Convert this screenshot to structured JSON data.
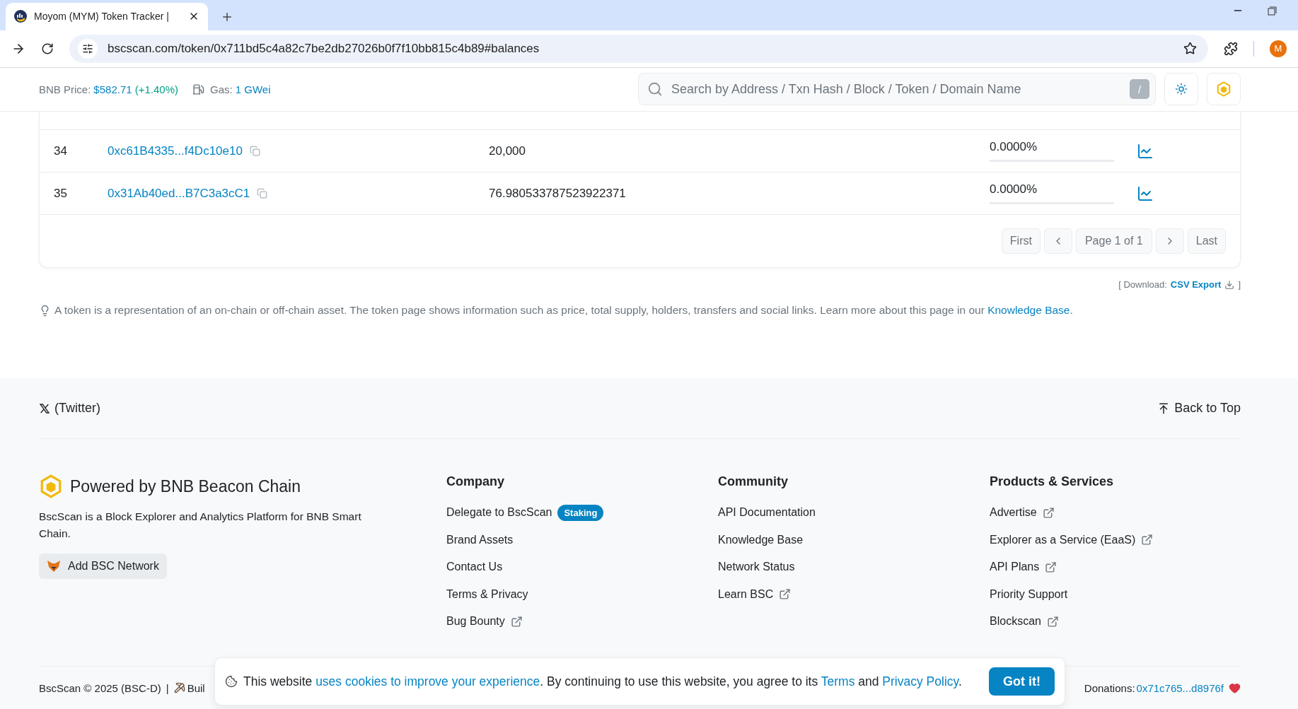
{
  "browser": {
    "tab_title": "Moyom (MYM) Token Tracker |",
    "url": "bscscan.com/token/0x711bd5c4a82c7be2db27026b0f7f10bb815c4b89#balances",
    "avatar": "M"
  },
  "header": {
    "price_label": "BNB Price:",
    "price": "$582.71",
    "change": "(+1.40%)",
    "gas_label": "Gas:",
    "gas": "1 GWei",
    "search_placeholder": "Search by Address / Txn Hash / Block / Token / Domain Name",
    "shortcut": "/"
  },
  "holders": {
    "rows": [
      {
        "rank": "34",
        "address": "0xc61B4335...f4Dc10e10",
        "quantity": "20,000",
        "percentage": "0.0000%",
        "level": 0
      },
      {
        "rank": "35",
        "address": "0x31Ab40ed...B7C3a3cC1",
        "quantity": "76.980533787523922371",
        "percentage": "0.0000%",
        "level": 0
      }
    ],
    "pagination": {
      "first": "First",
      "page": "Page 1 of 1",
      "last": "Last"
    }
  },
  "download": {
    "prefix": "[ Download:",
    "link": "CSV Export",
    "suffix": "]"
  },
  "info": {
    "text": "A token is a representation of an on-chain or off-chain asset. The token page shows information such as price, total supply, holders, transfers and social links. Learn more about this page in our ",
    "link": "Knowledge Base",
    "end": "."
  },
  "footer": {
    "twitter": "(Twitter)",
    "back_to_top": "Back to Top",
    "brand": "Powered by BNB Beacon Chain",
    "description": "BscScan is a Block Explorer and Analytics Platform for BNB Smart Chain.",
    "add_network": "Add BSC Network",
    "columns": [
      {
        "title": "Company",
        "links": [
          {
            "label": "Delegate to BscScan",
            "external": false,
            "badge": "Staking"
          },
          {
            "label": "Brand Assets",
            "external": false
          },
          {
            "label": "Contact Us",
            "external": false
          },
          {
            "label": "Terms & Privacy",
            "external": false
          },
          {
            "label": "Bug Bounty",
            "external": true
          }
        ]
      },
      {
        "title": "Community",
        "links": [
          {
            "label": "API Documentation",
            "external": false
          },
          {
            "label": "Knowledge Base",
            "external": false
          },
          {
            "label": "Network Status",
            "external": false
          },
          {
            "label": "Learn BSC",
            "external": true
          }
        ]
      },
      {
        "title": "Products & Services",
        "links": [
          {
            "label": "Advertise",
            "external": true
          },
          {
            "label": "Explorer as a Service (EaaS)",
            "external": true
          },
          {
            "label": "API Plans",
            "external": true
          },
          {
            "label": "Priority Support",
            "external": false
          },
          {
            "label": "Blockscan",
            "external": true
          }
        ]
      }
    ],
    "copyright": "BscScan © 2025 (BSC-D)",
    "separator": "|",
    "built": "Buil",
    "donations_label": "Donations:",
    "donations_address": "0x71c765...d8976f"
  },
  "cookie": {
    "start": "This website ",
    "link": "uses cookies to improve your experience",
    "middle": ". By continuing to use this website, you agree to its ",
    "terms": "Terms",
    "and": " and ",
    "privacy": "Privacy Policy",
    "end": ".",
    "button": "Got it!"
  }
}
